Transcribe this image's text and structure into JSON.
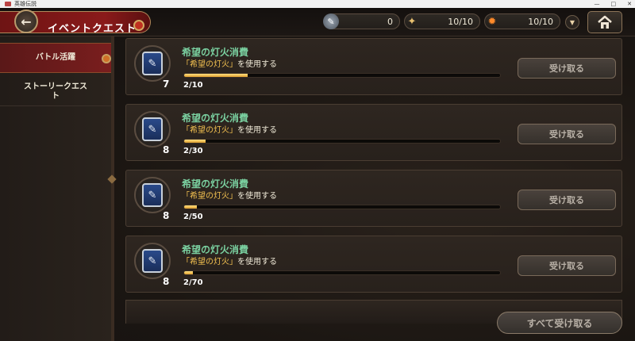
{
  "window": {
    "title": "英雄伝説",
    "controls": [
      "—",
      "□",
      "✕"
    ]
  },
  "header": {
    "back_icon": "back-arrow-icon",
    "title": "イベントクエスト",
    "resources": [
      {
        "name": "feather",
        "icon": "feather-icon",
        "value": "0"
      },
      {
        "name": "torch",
        "icon": "torch-icon",
        "value": "10/10"
      },
      {
        "name": "fire",
        "icon": "fire-icon",
        "value": "10/10"
      }
    ],
    "home_icon": "home-icon"
  },
  "sidebar": {
    "items": [
      {
        "label": "バトル活躍",
        "active": true
      },
      {
        "label": "ストーリークエスト",
        "active": false
      }
    ]
  },
  "quests": [
    {
      "title": "希望の灯火消費",
      "desc_prefix": "「希望の灯火」",
      "desc_suffix": "を使用する",
      "count": "7",
      "progress_text": "2/10",
      "progress": 0.2,
      "button": "受け取る"
    },
    {
      "title": "希望の灯火消費",
      "desc_prefix": "「希望の灯火」",
      "desc_suffix": "を使用する",
      "count": "8",
      "progress_text": "2/30",
      "progress": 0.0667,
      "button": "受け取る"
    },
    {
      "title": "希望の灯火消費",
      "desc_prefix": "「希望の灯火」",
      "desc_suffix": "を使用する",
      "count": "8",
      "progress_text": "2/50",
      "progress": 0.04,
      "button": "受け取る"
    },
    {
      "title": "希望の灯火消費",
      "desc_prefix": "「希望の灯火」",
      "desc_suffix": "を使用する",
      "count": "8",
      "progress_text": "2/70",
      "progress": 0.0286,
      "button": "受け取る"
    }
  ],
  "claim_all": "すべて受け取る",
  "colors": {
    "title_green": "#7ad0a0",
    "highlight_yellow": "#f2c050",
    "active_tab_red": "#7a1e1e",
    "progress_gold": "#e0a030"
  }
}
